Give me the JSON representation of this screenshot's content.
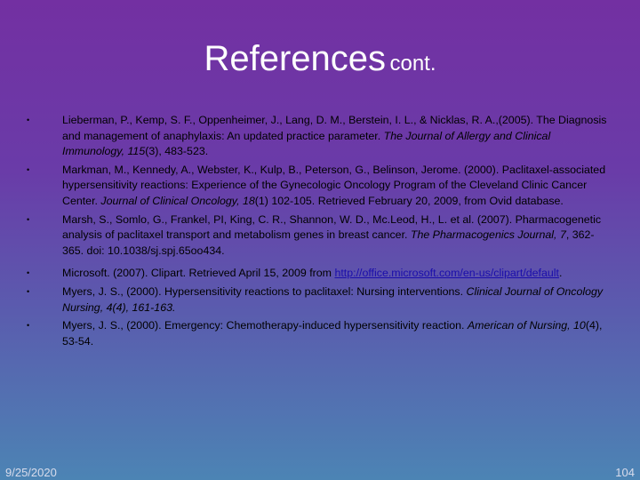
{
  "slide": {
    "title_main": "References",
    "title_sub": "cont.",
    "footer_date": "9/25/2020",
    "page_number": "104"
  },
  "references": [
    {
      "a": "Lieberman, P., Kemp, S. F., Oppenheimer, J., Lang, D. M., Berstein, I. L., & Nicklas, R. A.,(2005). The Diagnosis and management of anaphylaxis: An updated practice parameter. ",
      "i1": "The Journal of Allergy and Clinical Immunology, 115",
      "b": "(3), 483-523."
    },
    {
      "a": "Markman, M., Kennedy, A., Webster, K., Kulp, B., Peterson, G., Belinson, Jerome. (2000). Paclitaxel-associated hypersensitivity reactions: Experience of the Gynecologic Oncology Program of the Cleveland Clinic Cancer Center. ",
      "i1": "Journal of Clinical Oncology, 18",
      "b": "(1) 102-105. Retrieved February 20, 2009, from Ovid database."
    },
    {
      "a": "Marsh, S., Somlo, G., Frankel, PI, King, C. R., Shannon, W. D., Mc.Leod, H., L. et al. (2007). Pharmacogenetic analysis of paclitaxel transport and metabolism genes in breast cancer. ",
      "i1": "The Pharmacogenics Journal, 7",
      "b": ", 362-365. doi: 10.1038/sj.spj.65oo434."
    },
    {
      "a": "Microsoft. (2007). Clipart. Retrieved April 15, 2009 from ",
      "link": "http://office.microsoft.com/en-us/clipart/default",
      "b": "."
    },
    {
      "a": "Myers, J. S., (2000). Hypersensitivity reactions to paclitaxel: Nursing interventions. ",
      "i1": "Clinical Journal of Oncology Nursing, 4(4), 161-163."
    },
    {
      "a": "Myers, J. S., (2000). Emergency: Chemotherapy-induced hypersensitivity reaction. ",
      "i1": "American of Nursing, 10",
      "b": "(4), 53-54."
    }
  ],
  "icons": {
    "bullet": "•"
  }
}
